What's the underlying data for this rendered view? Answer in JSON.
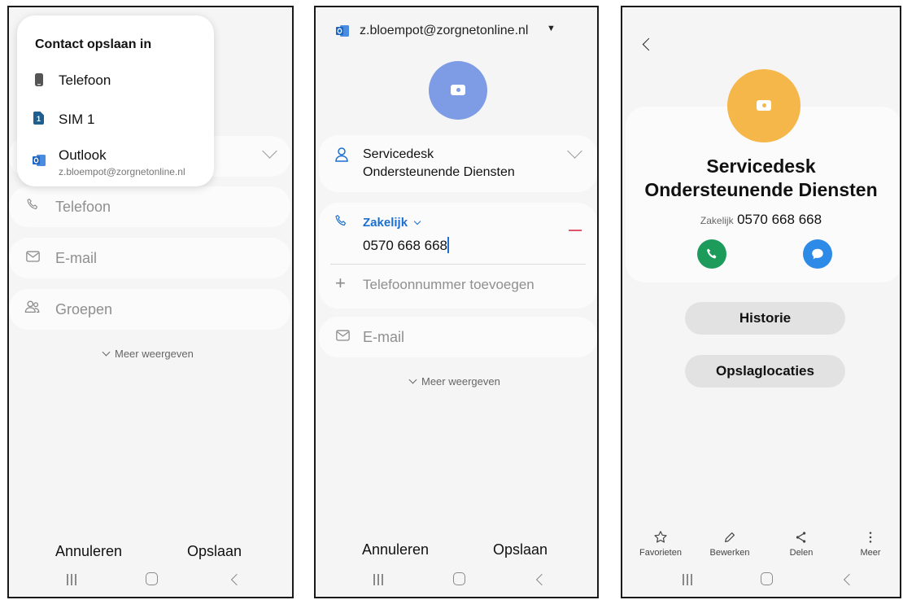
{
  "screen1": {
    "popup": {
      "title": "Contact opslaan in",
      "items": [
        {
          "label": "Telefoon",
          "icon": "phone-device-icon"
        },
        {
          "label": "SIM 1",
          "icon": "sim-icon",
          "badge": "1"
        },
        {
          "label": "Outlook",
          "sublabel": "z.bloempot@zorgnetonline.nl",
          "icon": "outlook-icon"
        }
      ]
    },
    "fields": {
      "telefoon": "Telefoon",
      "email": "E-mail",
      "groepen": "Groepen"
    },
    "meer": "Meer weergeven",
    "cancel": "Annuleren",
    "save": "Opslaan"
  },
  "screen2": {
    "account": "z.bloempot@zorgnetonline.nl",
    "name_line1": "Servicedesk",
    "name_line2": "Ondersteunende Diensten",
    "phone_type": "Zakelijk",
    "phone_value": "0570 668 668",
    "add_phone": "Telefoonnummer toevoegen",
    "email": "E-mail",
    "meer": "Meer weergeven",
    "cancel": "Annuleren",
    "save": "Opslaan"
  },
  "screen3": {
    "name_line1": "Servicedesk",
    "name_line2": "Ondersteunende Diensten",
    "phone_type": "Zakelijk",
    "phone_value": "0570 668 668",
    "btn_history": "Historie",
    "btn_storage": "Opslaglocaties",
    "toolbar": {
      "favorites": "Favorieten",
      "edit": "Bewerken",
      "share": "Delen",
      "more": "Meer"
    }
  },
  "colors": {
    "accent_blue": "#1a6fd1",
    "avatar_blue": "#7e9ce6",
    "avatar_orange": "#f6b74a",
    "call_green": "#1d9b5b",
    "message_blue": "#2d8ae6",
    "remove_red": "#e0556a",
    "outlook_blue": "#1f66c2"
  }
}
